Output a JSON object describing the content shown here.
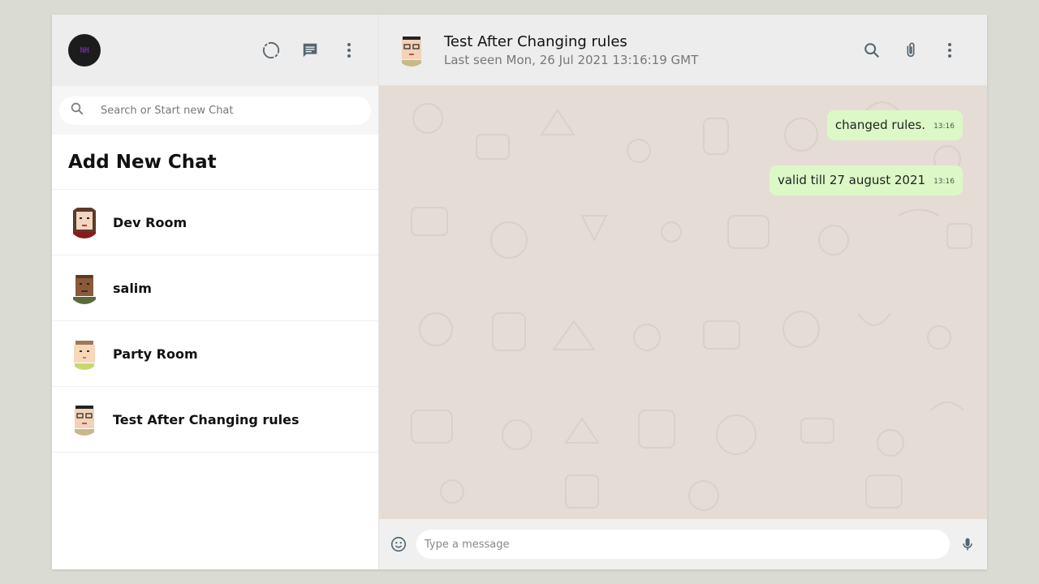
{
  "me": {
    "avatar_initials": "NH"
  },
  "sidebar": {
    "icons": [
      "status-icon",
      "new-chat-icon",
      "menu-icon"
    ],
    "search_placeholder": "Search or Start new Chat",
    "add_new_label": "Add New Chat",
    "chats": [
      {
        "name": "Dev Room",
        "avatar": "female-dark-hair-avatar"
      },
      {
        "name": "salim",
        "avatar": "male-dark-skin-avatar"
      },
      {
        "name": "Party Room",
        "avatar": "child-avatar"
      },
      {
        "name": "Test After Changing rules",
        "avatar": "male-glasses-avatar"
      }
    ]
  },
  "chat": {
    "title": "Test After Changing rules",
    "last_seen": "Last seen Mon, 26 Jul 2021 13:16:19 GMT",
    "icons": [
      "search-icon",
      "attach-icon",
      "menu-icon"
    ],
    "messages": [
      {
        "text": "changed rules.",
        "time": "13:16"
      },
      {
        "text": "valid till 27 august 2021",
        "time": "13:16"
      }
    ],
    "composer_placeholder": "Type a message"
  },
  "colors": {
    "header_bg": "#ededed",
    "chat_bg": "#e5ddd5",
    "outgoing_bubble": "#dcf8c6"
  }
}
